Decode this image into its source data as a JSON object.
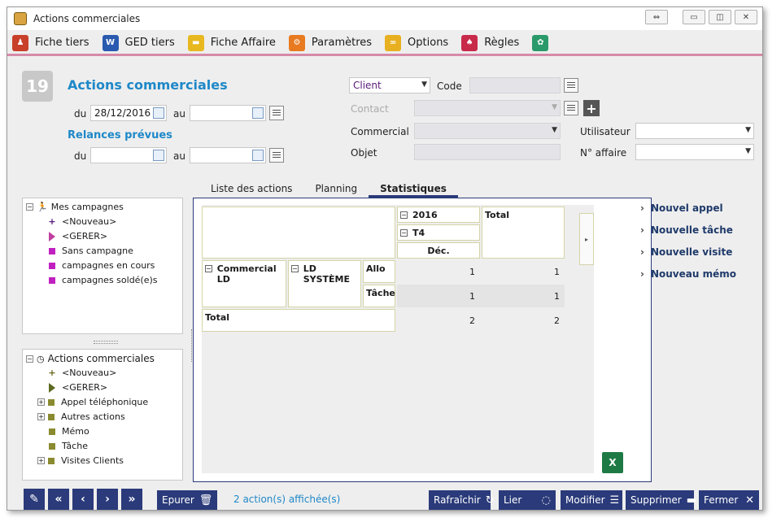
{
  "window": {
    "title": "Actions commerciales",
    "controls": [
      "⇔",
      "▭",
      "◫",
      "✕"
    ]
  },
  "menu": [
    {
      "label": "Fiche tiers",
      "icon": "user-icon",
      "color": "#c8402a",
      "glyph": "♟"
    },
    {
      "label": "GED tiers",
      "icon": "word-icon",
      "color": "#2a5ab0",
      "glyph": "W"
    },
    {
      "label": "Fiche Affaire",
      "icon": "folder-icon",
      "color": "#e8b820",
      "glyph": "▬"
    },
    {
      "label": "Paramètres",
      "icon": "gear-icon",
      "color": "#e87a20",
      "glyph": "⚙"
    },
    {
      "label": "Options",
      "icon": "glasses-icon",
      "color": "#e8b020",
      "glyph": "∞"
    },
    {
      "label": "Règles",
      "icon": "cards-icon",
      "color": "#c82a4a",
      "glyph": "♠"
    },
    {
      "label": "",
      "icon": "palette-icon",
      "color": "#2a9a6a",
      "glyph": "✿"
    }
  ],
  "form": {
    "calendar_day": "19",
    "title": "Actions commerciales",
    "du_label": "du",
    "au_label": "au",
    "date_from": "28/12/2016",
    "date_to": "",
    "relances_title": "Relances prévues",
    "relance_from": "",
    "relance_to": "",
    "client_select": "Client",
    "code_label": "Code",
    "code_value": "",
    "contact_label": "Contact",
    "commercial_label": "Commercial",
    "objet_label": "Objet",
    "utilisateur_label": "Utilisateur",
    "affaire_label": "N° affaire"
  },
  "tabs": [
    {
      "label": "Liste des actions",
      "active": false
    },
    {
      "label": "Planning",
      "active": false
    },
    {
      "label": "Statistiques",
      "active": true
    }
  ],
  "campaign_tree": {
    "root": "Mes campagnes",
    "items": [
      "<Nouveau>",
      "<GERER>",
      "Sans campagne",
      "campagnes en cours",
      "campagnes soldé(e)s"
    ]
  },
  "actions_tree": {
    "root": "Actions commerciales",
    "items": [
      "<Nouveau>",
      "<GERER>",
      "Appel téléphonique",
      "Autres actions",
      "Mémo",
      "Tâche",
      "Visites Clients"
    ]
  },
  "pivot": {
    "year": "2016",
    "quarter": "T4",
    "month": "Déc.",
    "total_col": "Total",
    "row_group": "Commercial LD",
    "row_sub": "LD SYSTÈME",
    "rows": [
      {
        "label": "Allo",
        "value": "1",
        "total": "1"
      },
      {
        "label": "Tâche",
        "value": "1",
        "total": "1"
      }
    ],
    "grand_total_label": "Total",
    "grand_total_value": "2",
    "grand_total_total": "2"
  },
  "actions": [
    "Nouvel appel",
    "Nouvelle tâche",
    "Nouvelle visite",
    "Nouveau mémo"
  ],
  "bottom": {
    "nav": [
      "✎",
      "«",
      "‹",
      "›",
      "»"
    ],
    "epurer": "Epurer",
    "status": "2 action(s) affichée(s)",
    "rafraichir": "Rafraîchir",
    "lier": "Lier",
    "modifier": "Modifier",
    "supprimer": "Supprimer",
    "fermer": "Fermer"
  }
}
